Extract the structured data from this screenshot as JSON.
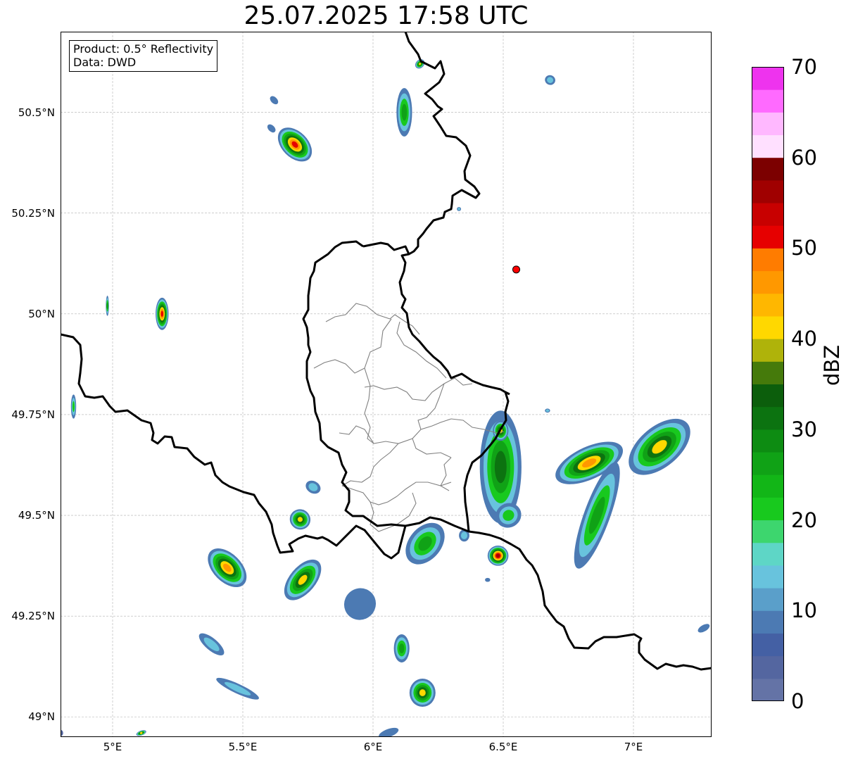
{
  "title": "25.07.2025 17:58 UTC",
  "info": {
    "product": "Product: 0.5° Reflectivity",
    "data": "Data: DWD"
  },
  "map": {
    "lon_range": [
      4.8,
      7.3
    ],
    "lat_range": [
      48.95,
      50.7
    ],
    "x_ticks": [
      {
        "value": 5.0,
        "label": "5°E"
      },
      {
        "value": 5.5,
        "label": "5.5°E"
      },
      {
        "value": 6.0,
        "label": "6°E"
      },
      {
        "value": 6.5,
        "label": "6.5°E"
      },
      {
        "value": 7.0,
        "label": "7°E"
      }
    ],
    "y_ticks": [
      {
        "value": 49.0,
        "label": "49°N"
      },
      {
        "value": 49.25,
        "label": "49.25°N"
      },
      {
        "value": 49.5,
        "label": "49.5°N"
      },
      {
        "value": 49.75,
        "label": "49.75°N"
      },
      {
        "value": 50.0,
        "label": "50°N"
      },
      {
        "value": 50.25,
        "label": "50.25°N"
      },
      {
        "value": 50.5,
        "label": "50.5°N"
      }
    ],
    "radar_site": {
      "lon": 6.55,
      "lat": 50.11,
      "color": "#ff0000"
    },
    "echoes": [
      {
        "lon": 5.7,
        "lat": 50.42,
        "rx": 0.05,
        "ry": 0.05,
        "angle": -45,
        "peak": 52
      },
      {
        "lon": 5.62,
        "lat": 50.53,
        "rx": 0.012,
        "ry": 0.012,
        "angle": -45,
        "peak": 10
      },
      {
        "lon": 5.61,
        "lat": 50.46,
        "rx": 0.012,
        "ry": 0.012,
        "angle": -45,
        "peak": 12
      },
      {
        "lon": 6.12,
        "lat": 50.5,
        "rx": 0.03,
        "ry": 0.06,
        "angle": 0,
        "peak": 30
      },
      {
        "lon": 6.18,
        "lat": 50.62,
        "rx": 0.02,
        "ry": 0.01,
        "angle": -45,
        "peak": 42
      },
      {
        "lon": 6.68,
        "lat": 50.58,
        "rx": 0.02,
        "ry": 0.012,
        "angle": 20,
        "peak": 18
      },
      {
        "lon": 6.33,
        "lat": 50.26,
        "rx": 0.008,
        "ry": 0.005,
        "angle": 0,
        "peak": 14
      },
      {
        "lon": 5.19,
        "lat": 50.0,
        "rx": 0.025,
        "ry": 0.04,
        "angle": 0,
        "peak": 54
      },
      {
        "lon": 4.98,
        "lat": 50.02,
        "rx": 0.006,
        "ry": 0.025,
        "angle": 0,
        "peak": 30
      },
      {
        "lon": 4.85,
        "lat": 49.77,
        "rx": 0.01,
        "ry": 0.03,
        "angle": 0,
        "peak": 22
      },
      {
        "lon": 6.49,
        "lat": 49.62,
        "rx": 0.08,
        "ry": 0.14,
        "angle": 0,
        "peak": 32
      },
      {
        "lon": 6.49,
        "lat": 49.71,
        "rx": 0.03,
        "ry": 0.025,
        "angle": 0,
        "peak": 42
      },
      {
        "lon": 6.52,
        "lat": 49.5,
        "rx": 0.05,
        "ry": 0.03,
        "angle": -30,
        "peak": 24
      },
      {
        "lon": 6.2,
        "lat": 49.43,
        "rx": 0.09,
        "ry": 0.04,
        "angle": -50,
        "peak": 30
      },
      {
        "lon": 6.35,
        "lat": 49.45,
        "rx": 0.02,
        "ry": 0.015,
        "angle": 0,
        "peak": 16
      },
      {
        "lon": 6.48,
        "lat": 49.4,
        "rx": 0.04,
        "ry": 0.025,
        "angle": 0,
        "peak": 56
      },
      {
        "lon": 6.44,
        "lat": 49.34,
        "rx": 0.01,
        "ry": 0.005,
        "angle": 0,
        "peak": 10
      },
      {
        "lon": 6.83,
        "lat": 49.63,
        "rx": 0.14,
        "ry": 0.04,
        "angle": -25,
        "peak": 46
      },
      {
        "lon": 6.86,
        "lat": 49.5,
        "rx": 0.05,
        "ry": 0.14,
        "angle": 20,
        "peak": 30
      },
      {
        "lon": 7.1,
        "lat": 49.67,
        "rx": 0.14,
        "ry": 0.05,
        "angle": -40,
        "peak": 44
      },
      {
        "lon": 6.67,
        "lat": 49.76,
        "rx": 0.01,
        "ry": 0.005,
        "angle": 0,
        "peak": 16
      },
      {
        "lon": 7.27,
        "lat": 49.22,
        "rx": 0.025,
        "ry": 0.008,
        "angle": -30,
        "peak": 12
      },
      {
        "lon": 5.44,
        "lat": 49.37,
        "rx": 0.09,
        "ry": 0.035,
        "angle": 45,
        "peak": 46
      },
      {
        "lon": 5.73,
        "lat": 49.34,
        "rx": 0.05,
        "ry": 0.06,
        "angle": 40,
        "peak": 44
      },
      {
        "lon": 5.72,
        "lat": 49.49,
        "rx": 0.04,
        "ry": 0.025,
        "angle": 30,
        "peak": 40
      },
      {
        "lon": 5.77,
        "lat": 49.57,
        "rx": 0.03,
        "ry": 0.015,
        "angle": 30,
        "peak": 16
      },
      {
        "lon": 5.95,
        "lat": 49.28,
        "rx": 0.06,
        "ry": 0.04,
        "angle": 45,
        "peak": 12
      },
      {
        "lon": 5.38,
        "lat": 49.18,
        "rx": 0.06,
        "ry": 0.015,
        "angle": 40,
        "peak": 18
      },
      {
        "lon": 5.48,
        "lat": 49.07,
        "rx": 0.09,
        "ry": 0.012,
        "angle": 25,
        "peak": 14
      },
      {
        "lon": 6.11,
        "lat": 49.17,
        "rx": 0.03,
        "ry": 0.035,
        "angle": 0,
        "peak": 30
      },
      {
        "lon": 6.19,
        "lat": 49.06,
        "rx": 0.05,
        "ry": 0.035,
        "angle": 0,
        "peak": 44
      },
      {
        "lon": 6.06,
        "lat": 48.96,
        "rx": 0.04,
        "ry": 0.01,
        "angle": -20,
        "peak": 12
      },
      {
        "lon": 5.11,
        "lat": 48.96,
        "rx": 0.02,
        "ry": 0.006,
        "angle": -20,
        "peak": 40
      },
      {
        "lon": 4.8,
        "lat": 48.96,
        "rx": 0.01,
        "ry": 0.008,
        "angle": 0,
        "peak": 4
      }
    ]
  },
  "colorbar": {
    "label": "dBZ",
    "min": 0,
    "max": 70,
    "step": 2.5,
    "colors": [
      "#6473a6",
      "#5466a0",
      "#4460a4",
      "#4c7ab3",
      "#5a9fca",
      "#68c3dd",
      "#5ed6c6",
      "#3dd66e",
      "#18c91e",
      "#12b617",
      "#10a216",
      "#0d8c12",
      "#0c7310",
      "#0c5e0c",
      "#457a0b",
      "#afb30a",
      "#ffd800",
      "#ffb700",
      "#ff9800",
      "#ff7c00",
      "#e60000",
      "#c80000",
      "#a00000",
      "#7c0000",
      "#ffe0ff",
      "#ffb8ff",
      "#ff6aff",
      "#ee33ee"
    ],
    "ticks": [
      {
        "value": 0,
        "label": "0"
      },
      {
        "value": 10,
        "label": "10"
      },
      {
        "value": 20,
        "label": "20"
      },
      {
        "value": 30,
        "label": "30"
      },
      {
        "value": 40,
        "label": "40"
      },
      {
        "value": 50,
        "label": "50"
      },
      {
        "value": 60,
        "label": "60"
      },
      {
        "value": 70,
        "label": "70"
      }
    ]
  }
}
